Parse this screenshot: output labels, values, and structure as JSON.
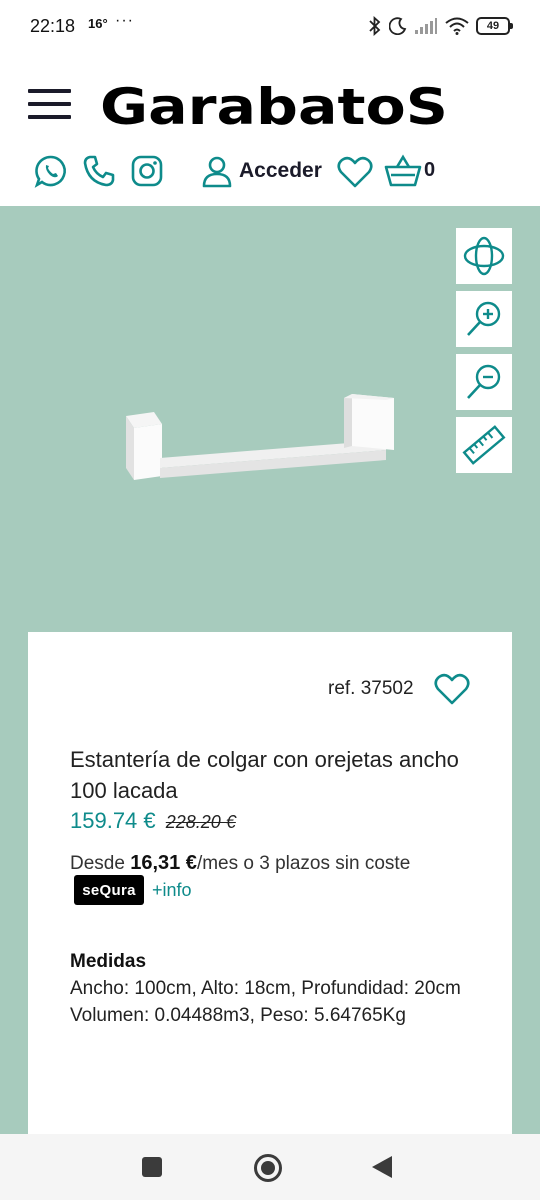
{
  "status_bar": {
    "time": "22:18",
    "temperature": "16°",
    "overflow": "···",
    "battery": "49"
  },
  "header": {
    "logo_text": "GarabatoS",
    "login_label": "Acceder",
    "cart_count": "0",
    "accent_color": "#0e8b8b",
    "icons": [
      "menu-icon",
      "whatsapp-icon",
      "phone-icon",
      "instagram-icon",
      "user-icon",
      "heart-icon",
      "basket-icon"
    ]
  },
  "viewer": {
    "background": "#a7cbbd",
    "tools": [
      "rotate-360-icon",
      "zoom-in-icon",
      "zoom-out-icon",
      "ruler-icon"
    ]
  },
  "product": {
    "ref": "ref. 37502",
    "title": "Estantería de colgar con orejetas ancho 100 lacada",
    "price": "159.74 €",
    "old_price": "228.20 €",
    "finance_prefix": "Desde ",
    "finance_amount": "16,31 €",
    "finance_suffix": "/mes o 3 plazos sin coste",
    "sequra_label": "seQura",
    "more_info": "+info",
    "measures_heading": "Medidas",
    "measures_dims": "Ancho: 100cm, Alto: 18cm, Profundidad: 20cm",
    "measures_volume": "Volumen: 0.04488m3, Peso: 5.64765Kg"
  }
}
